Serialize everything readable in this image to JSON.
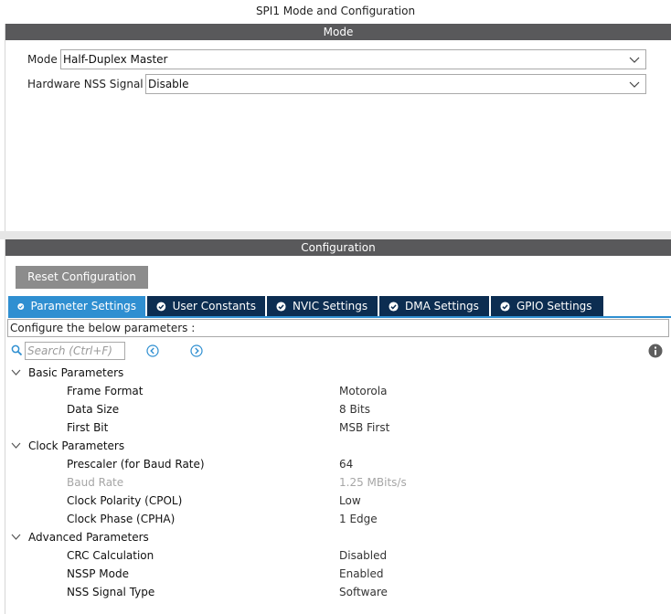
{
  "window": {
    "title": "SPI1 Mode and Configuration"
  },
  "mode": {
    "header": "Mode",
    "fields": [
      {
        "label": "Mode",
        "value": "Half-Duplex Master"
      },
      {
        "label": "Hardware NSS Signal",
        "value": "Disable"
      }
    ]
  },
  "config": {
    "header": "Configuration",
    "reset_label": "Reset Configuration",
    "tabs": [
      {
        "label": "Parameter Settings",
        "active": true
      },
      {
        "label": "User Constants",
        "active": false
      },
      {
        "label": "NVIC Settings",
        "active": false
      },
      {
        "label": "DMA Settings",
        "active": false
      },
      {
        "label": "GPIO Settings",
        "active": false
      }
    ],
    "hint": "Configure the below parameters :",
    "search_placeholder": "Search (Ctrl+F)",
    "groups": [
      {
        "label": "Basic Parameters",
        "items": [
          {
            "name": "Frame Format",
            "value": "Motorola"
          },
          {
            "name": "Data Size",
            "value": "8 Bits"
          },
          {
            "name": "First Bit",
            "value": "MSB First"
          }
        ]
      },
      {
        "label": "Clock Parameters",
        "items": [
          {
            "name": "Prescaler (for Baud Rate)",
            "value": "64"
          },
          {
            "name": "Baud Rate",
            "value": "1.25 MBits/s"
          },
          {
            "name": "Clock Polarity (CPOL)",
            "value": "Low"
          },
          {
            "name": "Clock Phase (CPHA)",
            "value": "1 Edge"
          }
        ]
      },
      {
        "label": "Advanced Parameters",
        "items": [
          {
            "name": "CRC Calculation",
            "value": "Disabled"
          },
          {
            "name": "NSSP Mode",
            "value": "Enabled"
          },
          {
            "name": "NSS Signal Type",
            "value": "Software"
          }
        ]
      }
    ]
  },
  "colors": {
    "header_bg": "#59595b",
    "tab_bg": "#0c2d51",
    "tab_active_bg": "#2f8fd1",
    "nav_icon": "#2f8fd1"
  }
}
